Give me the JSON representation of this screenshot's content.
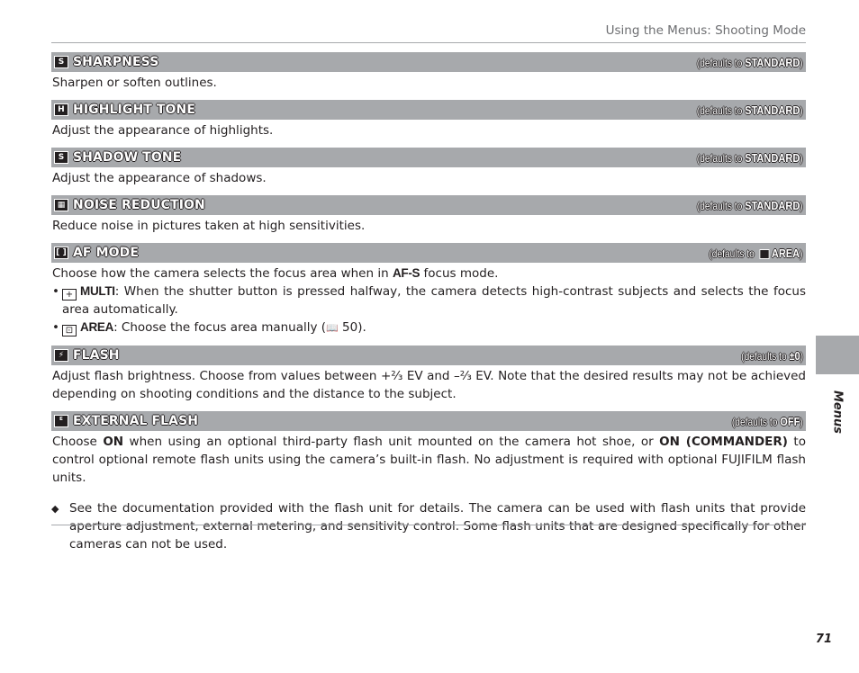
{
  "running_head": "Using the Menus: Shooting Mode",
  "side_tab": "Menus",
  "page_number": "71",
  "defaults_prefix": "defaults to",
  "sections": [
    {
      "icon": "sharpness-icon",
      "icon_glyph": "S",
      "title": "SHARPNESS",
      "default": "STANDARD",
      "body": "Sharpen or soften outlines."
    },
    {
      "icon": "highlight-tone-icon",
      "icon_glyph": "H",
      "title": "HIGHLIGHT TONE",
      "default": "STANDARD",
      "body": "Adjust the appearance of highlights."
    },
    {
      "icon": "shadow-tone-icon",
      "icon_glyph": "S",
      "title": "SHADOW TONE",
      "default": "STANDARD",
      "body": "Adjust the appearance of shadows."
    },
    {
      "icon": "noise-reduction-icon",
      "icon_glyph": "▦",
      "title": "NOISE REDUCTION",
      "default": "STANDARD",
      "body": "Reduce noise in pictures taken at high sensitivities."
    },
    {
      "icon": "af-mode-icon",
      "icon_glyph": "[ ]",
      "title": "AF MODE",
      "default": "AREA",
      "body_pre": "Choose how the camera selects the focus area when in ",
      "body_bold": "AF-S",
      "body_post": " focus mode.",
      "bullets": [
        {
          "icon_glyph": "+",
          "label": "MULTI",
          "text": ": When the shutter button is pressed halfway, the camera detects high-contrast subjects and selects the focus area automatically."
        },
        {
          "icon_glyph": "⊡",
          "label": "AREA",
          "text": ": Choose the focus area manually (",
          "ref_icon": "📖",
          "ref_page": " 50)."
        }
      ]
    },
    {
      "icon": "flash-compensation-icon",
      "icon_glyph": "⚡",
      "title": "FLASH",
      "default": "±0",
      "body": "Adjust flash brightness. Choose from values between +⅔ EV and –⅔ EV. Note that the desired results may not be achieved depending on shooting conditions and the distance to the subject."
    },
    {
      "icon": "external-flash-icon",
      "icon_glyph": "ᴱ",
      "title": "EXTERNAL FLASH",
      "default": "OFF",
      "body_parts": [
        "Choose ",
        "ON",
        " when using an optional third-party flash unit mounted on the camera hot shoe, or ",
        "ON (COMMANDER)",
        " to control optional remote flash units using the camera’s built-in flash.  No adjustment is required with optional FUJIFILM flash units."
      ],
      "note": "See the documentation provided with the flash unit for details. The camera can be used with flash units that provide aperture adjustment, external metering, and sensitivity control.  Some flash units that are designed specifically for other cameras can not be used."
    }
  ]
}
